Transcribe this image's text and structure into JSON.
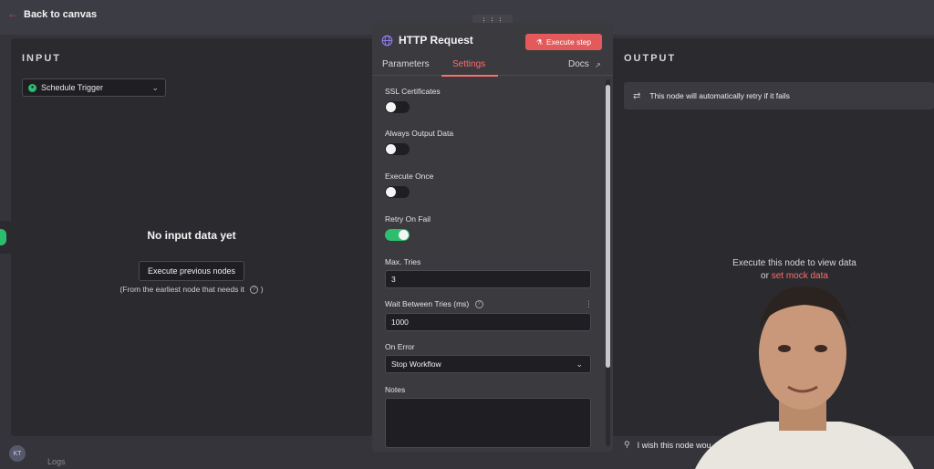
{
  "topbar": {
    "back_label": "Back to canvas"
  },
  "input_panel": {
    "heading": "INPUT",
    "trigger_select": "Schedule Trigger",
    "empty_title": "No input data yet",
    "execute_previous_label": "Execute previous nodes",
    "earliest_note": "(From the earliest node that needs it"
  },
  "node": {
    "title": "HTTP Request",
    "execute_step_label": "Execute step",
    "tabs": {
      "parameters": "Parameters",
      "settings": "Settings",
      "docs": "Docs"
    },
    "settings": {
      "ssl_label": "SSL Certificates",
      "ssl_on": false,
      "always_output_label": "Always Output Data",
      "always_output_on": false,
      "execute_once_label": "Execute Once",
      "execute_once_on": false,
      "retry_label": "Retry On Fail",
      "retry_on": true,
      "max_tries_label": "Max. Tries",
      "max_tries_value": "3",
      "wait_label": "Wait Between Tries (ms)",
      "wait_value": "1000",
      "on_error_label": "On Error",
      "on_error_value": "Stop Workflow",
      "notes_label": "Notes"
    }
  },
  "output_panel": {
    "heading": "OUTPUT",
    "retry_banner": "This node will automatically retry if it fails",
    "execute_view_line1": "Execute this node to view data",
    "execute_view_or": "or",
    "mock_link": "set mock data",
    "wish_text": "I wish this node wou"
  },
  "footer": {
    "logs_label": "Logs",
    "avatar_initials": "KT"
  },
  "colors": {
    "accent": "#ff6d6d",
    "success": "#2dbd6e",
    "execute_button": "#e45a5a"
  }
}
